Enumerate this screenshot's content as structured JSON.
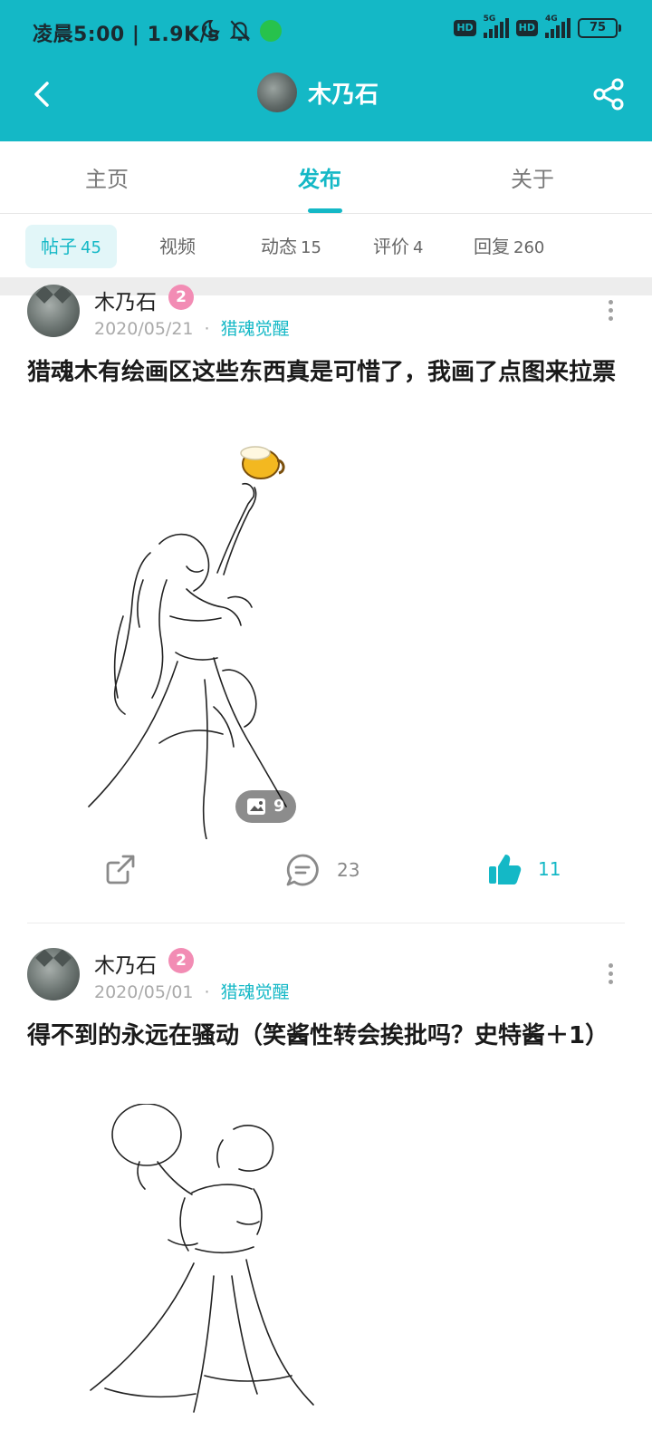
{
  "status_bar": {
    "time": "凌晨5:00 | 1.9K/s",
    "hd1": "HD",
    "net1": "5G",
    "hd2": "HD",
    "net2": "4G",
    "battery": "75"
  },
  "header": {
    "title": "木乃石",
    "accent_color": "#14b8c6"
  },
  "tabs": [
    {
      "label": "主页"
    },
    {
      "label": "发布"
    },
    {
      "label": "关于"
    }
  ],
  "active_tab": "发布",
  "chips": [
    {
      "label": "帖子",
      "count": "45"
    },
    {
      "label": "视频",
      "count": ""
    },
    {
      "label": "动态",
      "count": "15"
    },
    {
      "label": "评价",
      "count": "4"
    },
    {
      "label": "回复",
      "count": "260"
    }
  ],
  "posts": [
    {
      "author": "木乃石",
      "level": "2",
      "date": "2020/05/21",
      "dot": "·",
      "forum": "猎魂觉醒",
      "title": "猎魂木有绘画区这些东西真是可惜了，我画了点图来拉票",
      "image_count": "9",
      "comments": "23",
      "likes": "11"
    },
    {
      "author": "木乃石",
      "level": "2",
      "date": "2020/05/01",
      "dot": "·",
      "forum": "猎魂觉醒",
      "title": "得不到的永远在骚动（笑酱性转会挨批吗？史特酱＋1）"
    }
  ]
}
